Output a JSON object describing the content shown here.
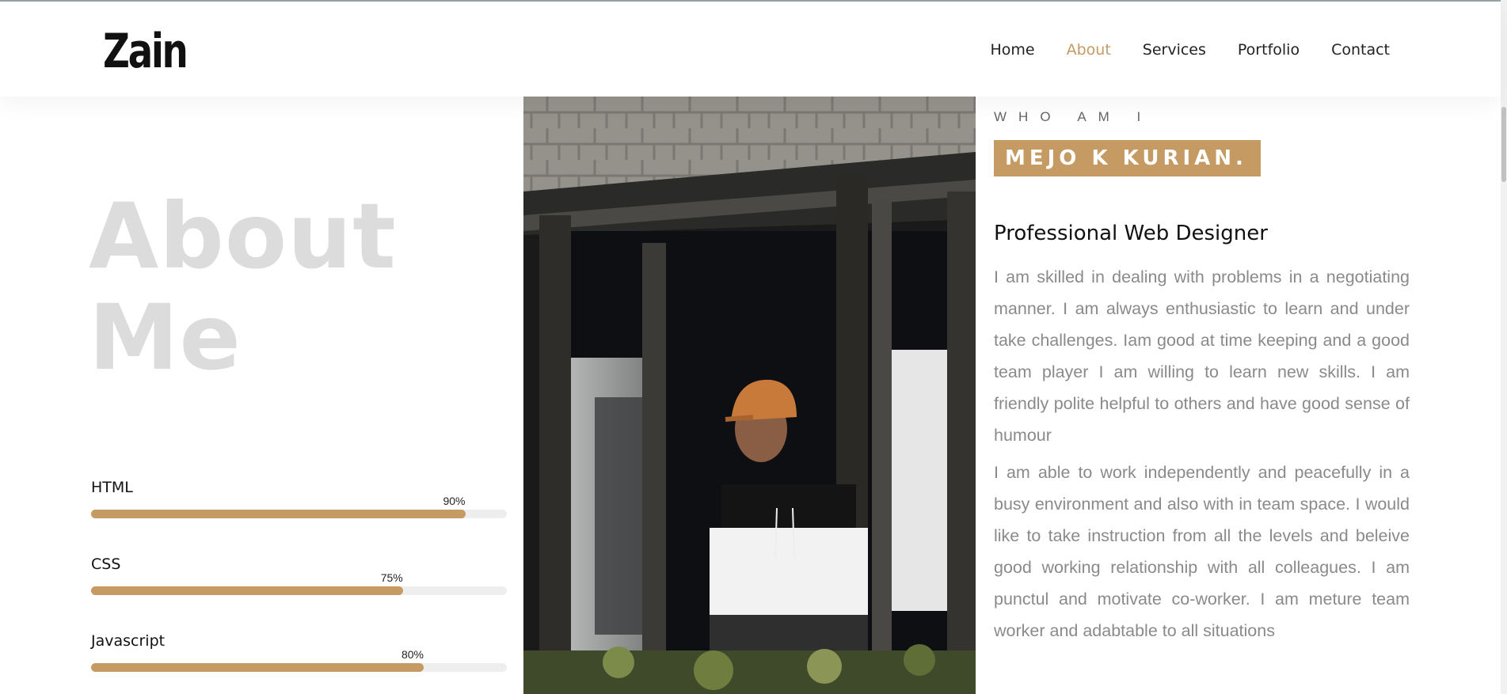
{
  "header": {
    "logo": "Zain",
    "nav": [
      "Home",
      "About",
      "Services",
      "Portfolio",
      "Contact"
    ],
    "active": "About"
  },
  "hero": {
    "title_line1": "About",
    "title_line2": "Me"
  },
  "skills": [
    {
      "name": "HTML",
      "percent_label": "90%",
      "value": 0.9
    },
    {
      "name": "CSS",
      "percent_label": "75%",
      "value": 0.75
    },
    {
      "name": "Javascript",
      "percent_label": "80%",
      "value": 0.8
    }
  ],
  "profile": {
    "eyebrow": "WHO AM I",
    "name": "MEJO K KURIAN.",
    "role": "Professional Web Designer",
    "paragraph1": "I am skilled in dealing with problems in a negotiating manner. I am always enthusiastic to learn and under take challenges. Iam good at time keeping and a good team player I am willing to learn new skills. I am friendly polite helpful to others and have good sense of humour",
    "paragraph2": "I am able to work independently and peacefully in a busy environment and also with in team space. I would like to take instruction from all the levels and beleive good working relationship with all colleagues. I am punctul and motivate co-worker. I am meture team worker and adabtable to all situations"
  },
  "colors": {
    "accent": "#c59a63",
    "muted_title": "#dcdcdc",
    "body_text": "#8a8a8a"
  },
  "photo": {
    "icon": "portrait-photo",
    "cap_color": "#c87a3a",
    "hoodie_colors": [
      "#111111",
      "#f4f4f4",
      "#333333"
    ]
  }
}
